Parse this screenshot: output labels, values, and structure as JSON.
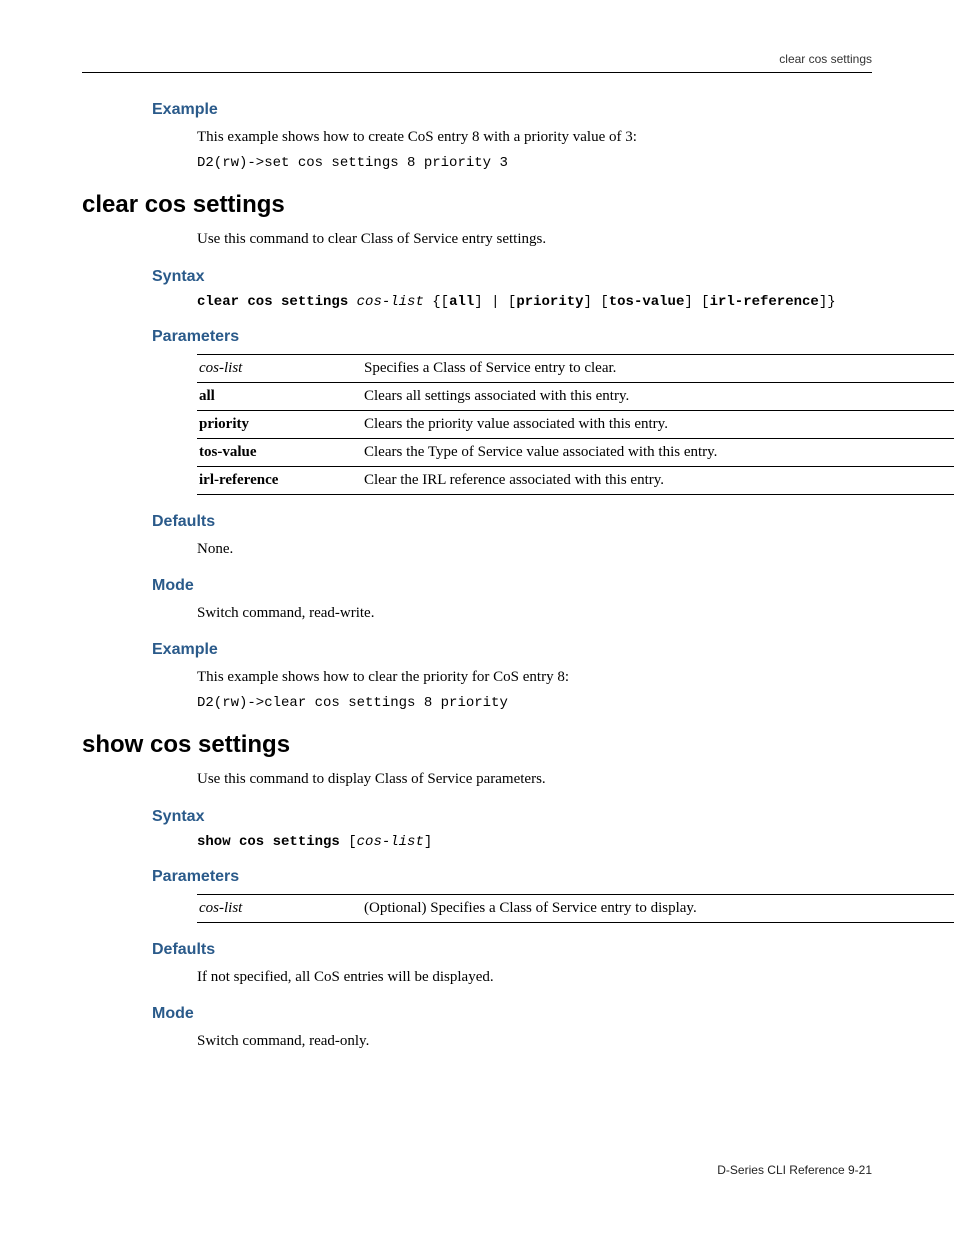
{
  "header": {
    "running": "clear cos settings"
  },
  "intro": {
    "example_h": "Example",
    "example_text": "This example shows how to create CoS entry 8 with a priority value of 3:",
    "example_code": "D2(rw)->set cos settings 8 priority 3"
  },
  "clear": {
    "title": "clear cos settings",
    "desc": "Use this command to clear Class of Service entry settings.",
    "syntax_h": "Syntax",
    "syntax": {
      "cmd": "clear cos settings",
      "arg": "cos-list",
      "rest1": " {[",
      "all": "all",
      "rest2": "] | [",
      "priority": "priority",
      "rest3": "] [",
      "tos": "tos-value",
      "rest4": "] [",
      "irl": "irl-reference",
      "rest5": "]}"
    },
    "params_h": "Parameters",
    "params": [
      {
        "name": "cos-list",
        "style": "em",
        "desc": "Specifies a Class of Service entry to clear."
      },
      {
        "name": "all",
        "style": "b",
        "desc": "Clears all settings associated with this entry."
      },
      {
        "name": "priority",
        "style": "b",
        "desc": "Clears the priority value associated with this entry."
      },
      {
        "name": "tos-value",
        "style": "b",
        "desc": "Clears the Type of Service value associated with this entry."
      },
      {
        "name": "irl-reference",
        "style": "b",
        "desc": "Clear the IRL reference associated with this entry."
      }
    ],
    "defaults_h": "Defaults",
    "defaults_text": "None.",
    "mode_h": "Mode",
    "mode_text": "Switch command, read-write.",
    "example_h": "Example",
    "example_text": "This example shows how to clear the priority for CoS entry 8:",
    "example_code": "D2(rw)->clear cos settings 8 priority"
  },
  "show": {
    "title": "show cos settings",
    "desc": "Use this command to display Class of Service parameters.",
    "syntax_h": "Syntax",
    "syntax": {
      "cmd": "show cos settings",
      "open": " [",
      "arg": "cos-list",
      "close": "]"
    },
    "params_h": "Parameters",
    "params": [
      {
        "name": "cos-list",
        "style": "em",
        "desc": "(Optional) Specifies a Class of Service entry to display."
      }
    ],
    "defaults_h": "Defaults",
    "defaults_text": "If not specified, all CoS entries will be displayed.",
    "mode_h": "Mode",
    "mode_text": "Switch command, read-only."
  },
  "footer": {
    "text": "D-Series CLI Reference    9-21"
  }
}
